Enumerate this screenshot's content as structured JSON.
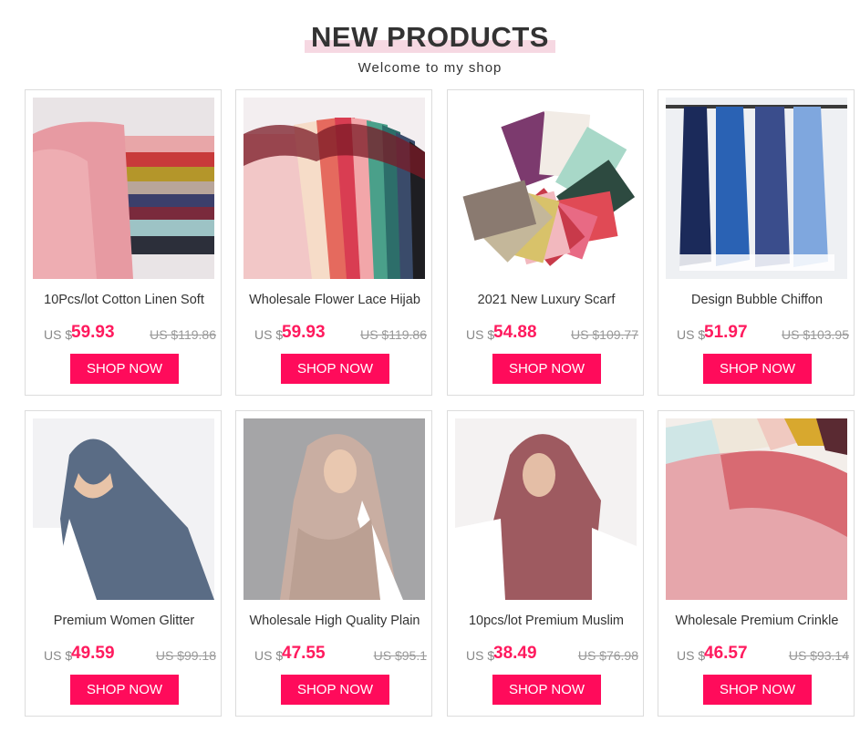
{
  "header": {
    "title": "NEW PRODUCTS",
    "subtitle": "Welcome to my shop"
  },
  "colors": {
    "accent": "#ff0b5b",
    "price": "#ff1a5e",
    "title_highlight": "#f6d8e2"
  },
  "products": [
    {
      "name": "10Pcs/lot Cotton Linen Soft",
      "currency": "US $",
      "price": "59.93",
      "old_price": "US $119.86",
      "button": "SHOP NOW",
      "image": "stacked-pink-lace-scarves"
    },
    {
      "name": "Wholesale Flower Lace Hijab",
      "currency": "US $",
      "price": "59.93",
      "old_price": "US $119.86",
      "button": "SHOP NOW",
      "image": "fanned-flower-lace-hijabs"
    },
    {
      "name": "2021 New Luxury Scarf",
      "currency": "US $",
      "price": "54.88",
      "old_price": "US $109.77",
      "button": "SHOP NOW",
      "image": "fanned-pattern-scarves"
    },
    {
      "name": "Design Bubble Chiffon",
      "currency": "US $",
      "price": "51.97",
      "old_price": "US $103.95",
      "button": "SHOP NOW",
      "image": "hanging-blue-chiffon-scarves"
    },
    {
      "name": "Premium Women Glitter",
      "currency": "US $",
      "price": "49.59",
      "old_price": "US $99.18",
      "button": "SHOP NOW",
      "image": "woman-blue-grey-hijab"
    },
    {
      "name": "Wholesale High Quality Plain",
      "currency": "US $",
      "price": "47.55",
      "old_price": "US $95.1",
      "button": "SHOP NOW",
      "image": "woman-beige-hijab"
    },
    {
      "name": "10pcs/lot Premium Muslim",
      "currency": "US $",
      "price": "38.49",
      "old_price": "US $76.98",
      "button": "SHOP NOW",
      "image": "woman-mauve-hijab"
    },
    {
      "name": "Wholesale Premium Crinkle",
      "currency": "US $",
      "price": "46.57",
      "old_price": "US $93.14",
      "button": "SHOP NOW",
      "image": "stacked-crinkle-scarves"
    }
  ]
}
